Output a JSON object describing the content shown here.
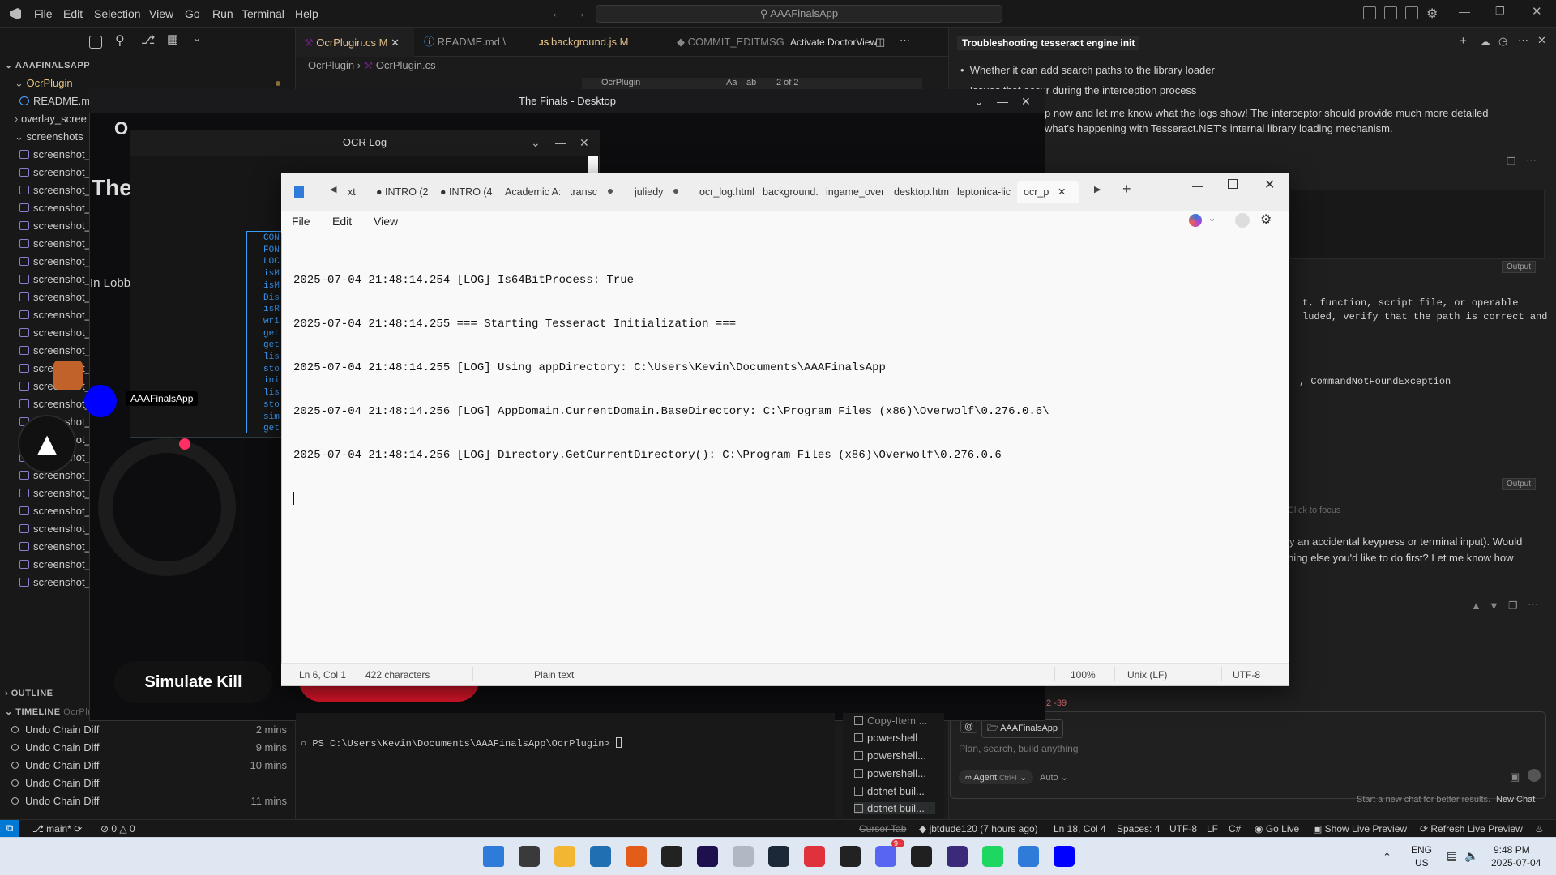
{
  "vscode": {
    "menu": [
      "File",
      "Edit",
      "Selection",
      "View",
      "Go",
      "Run",
      "Terminal",
      "Help"
    ],
    "search": "AAAFinalsApp",
    "tabs": [
      {
        "label": "OcrPlugin.cs",
        "status": "M",
        "icon": "csharp-icon"
      },
      {
        "label": "README.md",
        "status": "\\",
        "icon": "info-icon"
      },
      {
        "label": "background.js",
        "status": "M",
        "icon": "js-icon"
      },
      {
        "label": "COMMIT_EDITMSG",
        "status": "",
        "icon": "git-icon"
      },
      {
        "label": "Activate DoctorView",
        "status": "",
        "icon": ""
      }
    ],
    "breadcrumb": [
      "OcrPlugin",
      "OcrPlugin.cs"
    ],
    "find": {
      "query": "OcrPlugin",
      "result": "2 of 2",
      "aa": "Aa",
      "ab": "ab"
    },
    "explorer": {
      "root": "AAAFINALSAPP",
      "items": [
        "OcrPlugin",
        "README.md",
        "overlay_scree",
        "screenshots"
      ],
      "screenshot_label": "screenshot_",
      "outline": "OUTLINE",
      "timeline": "TIMELINE",
      "timeline_file": "OcrPlu"
    },
    "timeline": [
      {
        "label": "Undo Chain Diff",
        "when": "2 mins"
      },
      {
        "label": "Undo Chain Diff",
        "when": "9 mins"
      },
      {
        "label": "Undo Chain Diff",
        "when": "10 mins"
      },
      {
        "label": "Undo Chain Diff",
        "when": ""
      },
      {
        "label": "Undo Chain Diff",
        "when": "11 mins"
      }
    ],
    "terminal": {
      "prompt": "PS C:\\Users\\Kevin\\Documents\\AAAFinalsApp\\OcrPlugin>"
    },
    "terminal_list": [
      "Copy-Item ...",
      "powershell",
      "powershell...",
      "powershell...",
      "dotnet buil...",
      "dotnet buil..."
    ],
    "statusbar": {
      "branch": "main*",
      "problems": "0",
      "warnings": "0",
      "cursor_tab": "Cursor Tab",
      "blame": "jbtdude120 (7 hours ago)",
      "position": "Ln 18, Col 4",
      "spaces": "Spaces: 4",
      "encoding": "UTF-8",
      "eol": "LF",
      "lang": "C#",
      "golive": "Go Live",
      "showpreview": "Show Live Preview",
      "refresh": "Refresh Live Preview"
    }
  },
  "chat": {
    "title": "Troubleshooting tesseract engine init",
    "bullets": [
      "Whether it can add search paths to the library loader",
      "Issues that occur during the interception process"
    ],
    "para1a": "p now and let me know what the logs show! The interceptor should provide much more detailed",
    "para1b": " what's happening with Tesseract.NET's internal library loading mechanism.",
    "output_label": "Output",
    "out1a": "t, function, script file, or operable",
    "out1b": "luded, verify that the path is correct and",
    "out2": ", CommandNotFoundException",
    "focus": "Click to focus",
    "para2a": "y an accidental keypress or terminal input). Would",
    "para2b": "hing else you'd like to do first? Let me know how",
    "diffcount": "2 -39",
    "context": "AAAFinalsApp",
    "placeholder": "Plan, search, build anything",
    "agent": "Agent",
    "agent_shortcut": "Ctrl+I",
    "auto": "Auto",
    "newchat_hint": "Start a new chat for better results.",
    "newchat": "New Chat"
  },
  "finals": {
    "title": "The Finals - Desktop",
    "heading_o": "O",
    "heading_the": "The",
    "lobby": "In Lobb",
    "app_label": "AAAFinalsApp",
    "simulate": "Simulate Kill"
  },
  "ocrlog": {
    "title": "OCR Log",
    "code_lines": [
      "CON",
      "FON",
      "LOC",
      "isM",
      "isM",
      "Dis",
      "isR",
      "wri",
      "get",
      "get",
      "lis",
      "sto",
      "ini",
      "lis",
      "sto",
      "sim",
      "get"
    ]
  },
  "notepad": {
    "tabs": [
      "xt",
      "INTRO (2",
      "INTRO (4",
      "Academic A:",
      "transc",
      "juliedy",
      "ocr_log.html",
      "background.",
      "ingame_over",
      "desktop.htm",
      "leptonica-lic",
      "ocr_p"
    ],
    "menu": [
      "File",
      "Edit",
      "View"
    ],
    "lines": [
      "2025-07-04 21:48:14.254 [LOG] Is64BitProcess: True",
      "2025-07-04 21:48:14.255 === Starting Tesseract Initialization ===",
      "2025-07-04 21:48:14.255 [LOG] Using appDirectory: C:\\Users\\Kevin\\Documents\\AAAFinalsApp",
      "2025-07-04 21:48:14.256 [LOG] AppDomain.CurrentDomain.BaseDirectory: C:\\Program Files (x86)\\Overwolf\\0.276.0.6\\",
      "2025-07-04 21:48:14.256 [LOG] Directory.GetCurrentDirectory(): C:\\Program Files (x86)\\Overwolf\\0.276.0.6"
    ],
    "status": {
      "pos": "Ln 6, Col 1",
      "chars": "422 characters",
      "type": "Plain text",
      "zoom": "100%",
      "eol": "Unix (LF)",
      "enc": "UTF-8"
    }
  },
  "taskbar": {
    "lang1": "ENG",
    "lang2": "US",
    "time": "9:48 PM",
    "date": "2025-07-04",
    "badge": "9+",
    "apps": [
      "windows-start-icon",
      "minecraft-icon",
      "file-explorer-icon",
      "store-icon",
      "firefox-icon",
      "obs-icon",
      "after-effects-icon",
      "files-icon",
      "steam-icon",
      "opera-icon",
      "epic-icon",
      "discord-icon",
      "cursor-icon",
      "globe-icon",
      "spotify-icon",
      "notepad-icon",
      "blue-square-icon"
    ],
    "colors": [
      "#2f7bd9",
      "#3a3a3a",
      "#f2b632",
      "#1f6fb2",
      "#e45c1a",
      "#222222",
      "#1e0f4f",
      "#b0b8c4",
      "#1b2838",
      "#e0323c",
      "#222222",
      "#5865f2",
      "#202020",
      "#3b2a7a",
      "#1ed760",
      "#2f7bd9",
      "#0000ff"
    ]
  }
}
